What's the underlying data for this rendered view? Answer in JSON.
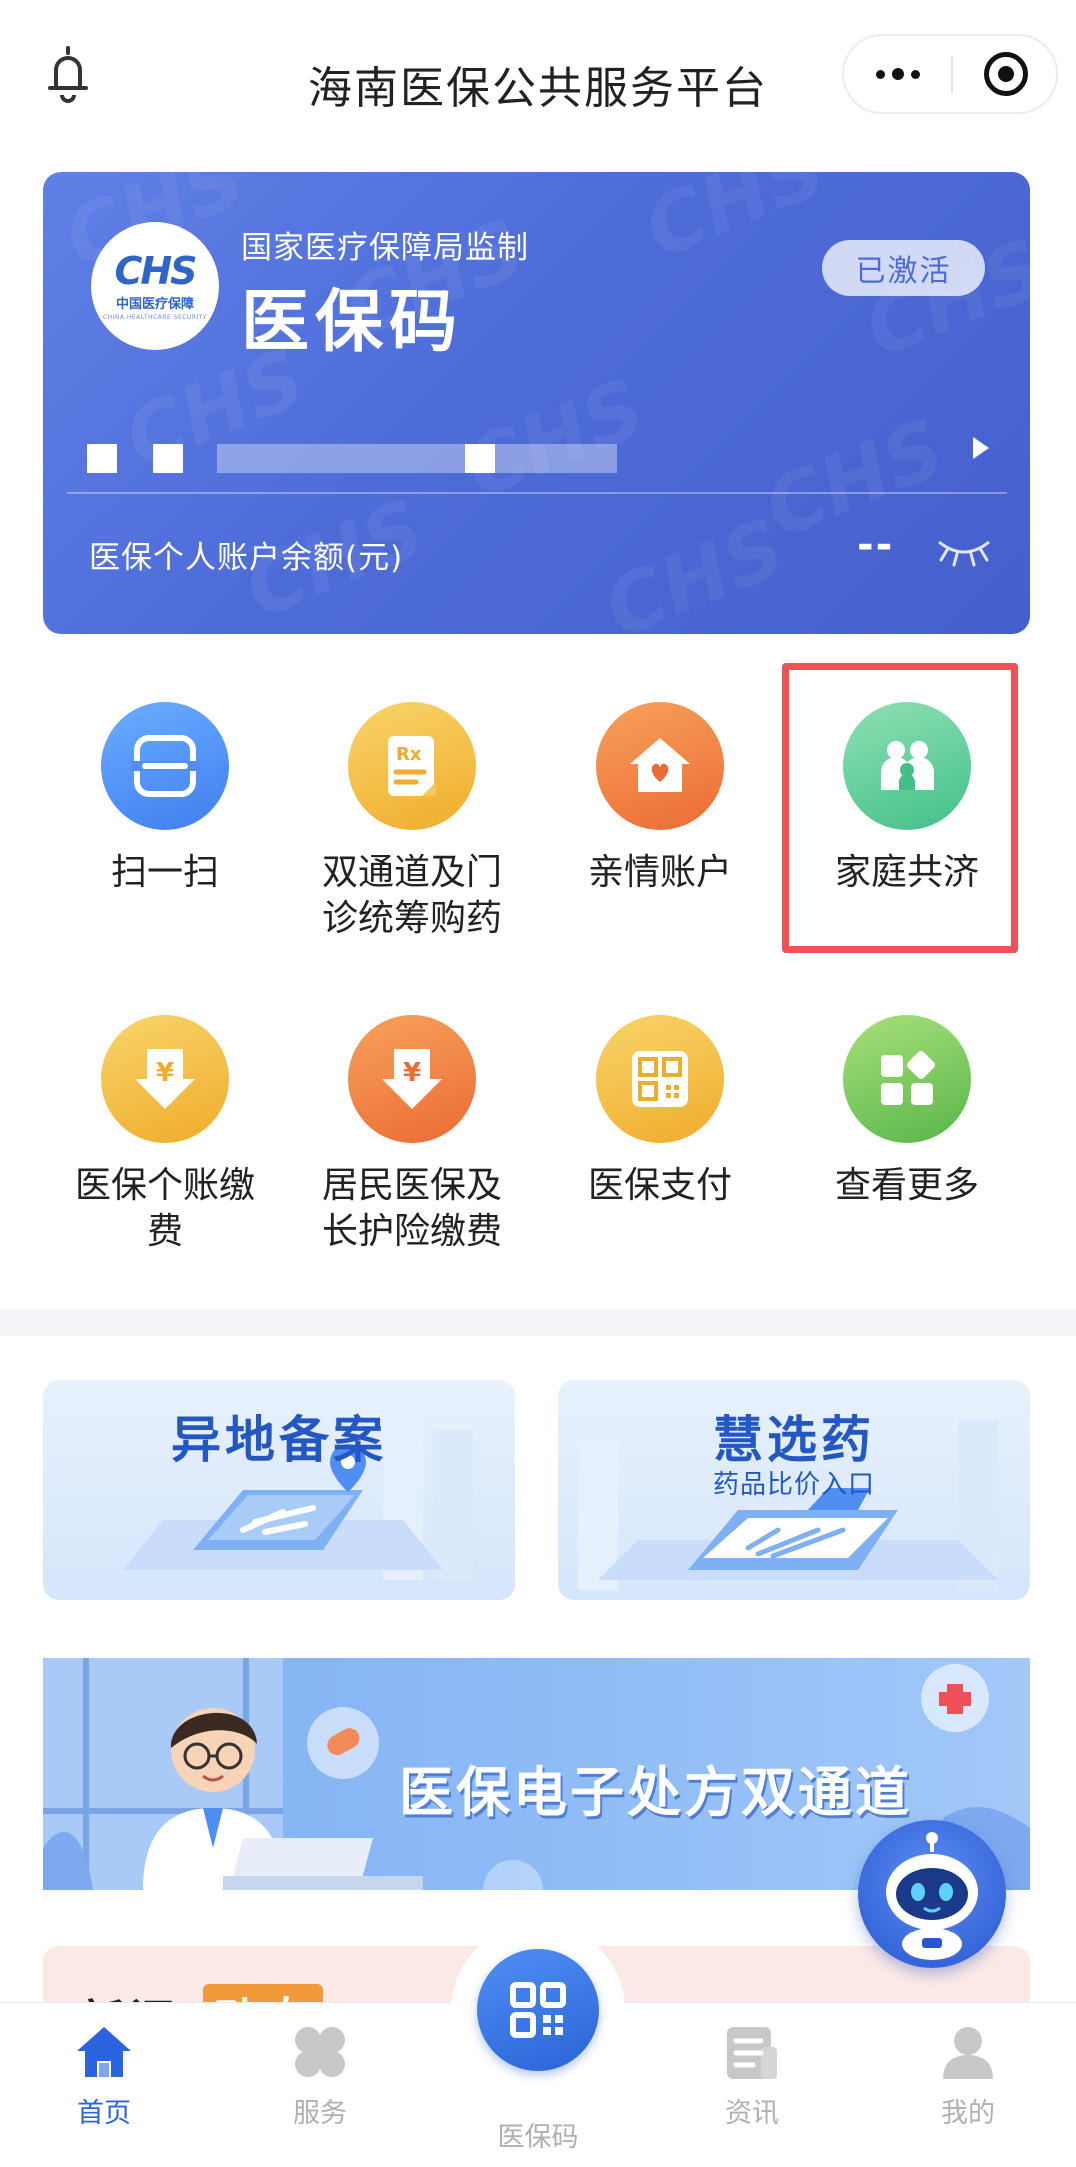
{
  "header": {
    "title": "海南医保公共服务平台",
    "icons": {
      "bell": "bell-icon",
      "more": "more-dots-icon",
      "close": "target-close-icon"
    }
  },
  "card": {
    "logo": {
      "text": "CHS",
      "cn": "中国医疗保障",
      "en": "CHINA HEALTHCARE SECURITY"
    },
    "supervise": "国家医疗保障局监制",
    "title": "医保码",
    "badge": "已激活",
    "balance_label": "医保个人账户余额(元)",
    "balance_value": "--",
    "colors": {
      "start": "#5f80e6",
      "end": "#4560cc"
    }
  },
  "services": [
    {
      "label": "扫一扫",
      "icon": "scan-icon",
      "color": "blue"
    },
    {
      "label": "双通道及门\n诊统筹购药",
      "icon": "prescription-icon",
      "color": "gold"
    },
    {
      "label": "亲情账户",
      "icon": "family-home-icon",
      "color": "orange"
    },
    {
      "label": "家庭共济",
      "icon": "family-share-icon",
      "color": "green",
      "highlighted": true
    },
    {
      "label": "医保个账缴\n费",
      "icon": "yuan-payment-icon",
      "color": "gold"
    },
    {
      "label": "居民医保及\n长护险缴费",
      "icon": "yuan-payment-icon",
      "color": "orange"
    },
    {
      "label": "医保支付",
      "icon": "qr-pay-icon",
      "color": "gold"
    },
    {
      "label": "查看更多",
      "icon": "more-apps-icon",
      "color": "lime"
    }
  ],
  "promos": [
    {
      "title": "异地备案",
      "subtitle": ""
    },
    {
      "title": "慧选药",
      "subtitle": "药品比价入口"
    }
  ],
  "banner": {
    "text": "医保电子处方双通道"
  },
  "news": {
    "title": "新闻",
    "badge": "动态"
  },
  "tabbar": {
    "tabs": [
      {
        "label": "首页",
        "icon": "home-icon",
        "active": true
      },
      {
        "label": "服务",
        "icon": "services-icon",
        "active": false
      },
      {
        "label": "医保码",
        "icon": "qr-code-icon",
        "active": false
      },
      {
        "label": "资讯",
        "icon": "news-icon",
        "active": false
      },
      {
        "label": "我的",
        "icon": "profile-icon",
        "active": false
      }
    ],
    "active_color": "#2c64df"
  },
  "highlight_color": "#f05058"
}
